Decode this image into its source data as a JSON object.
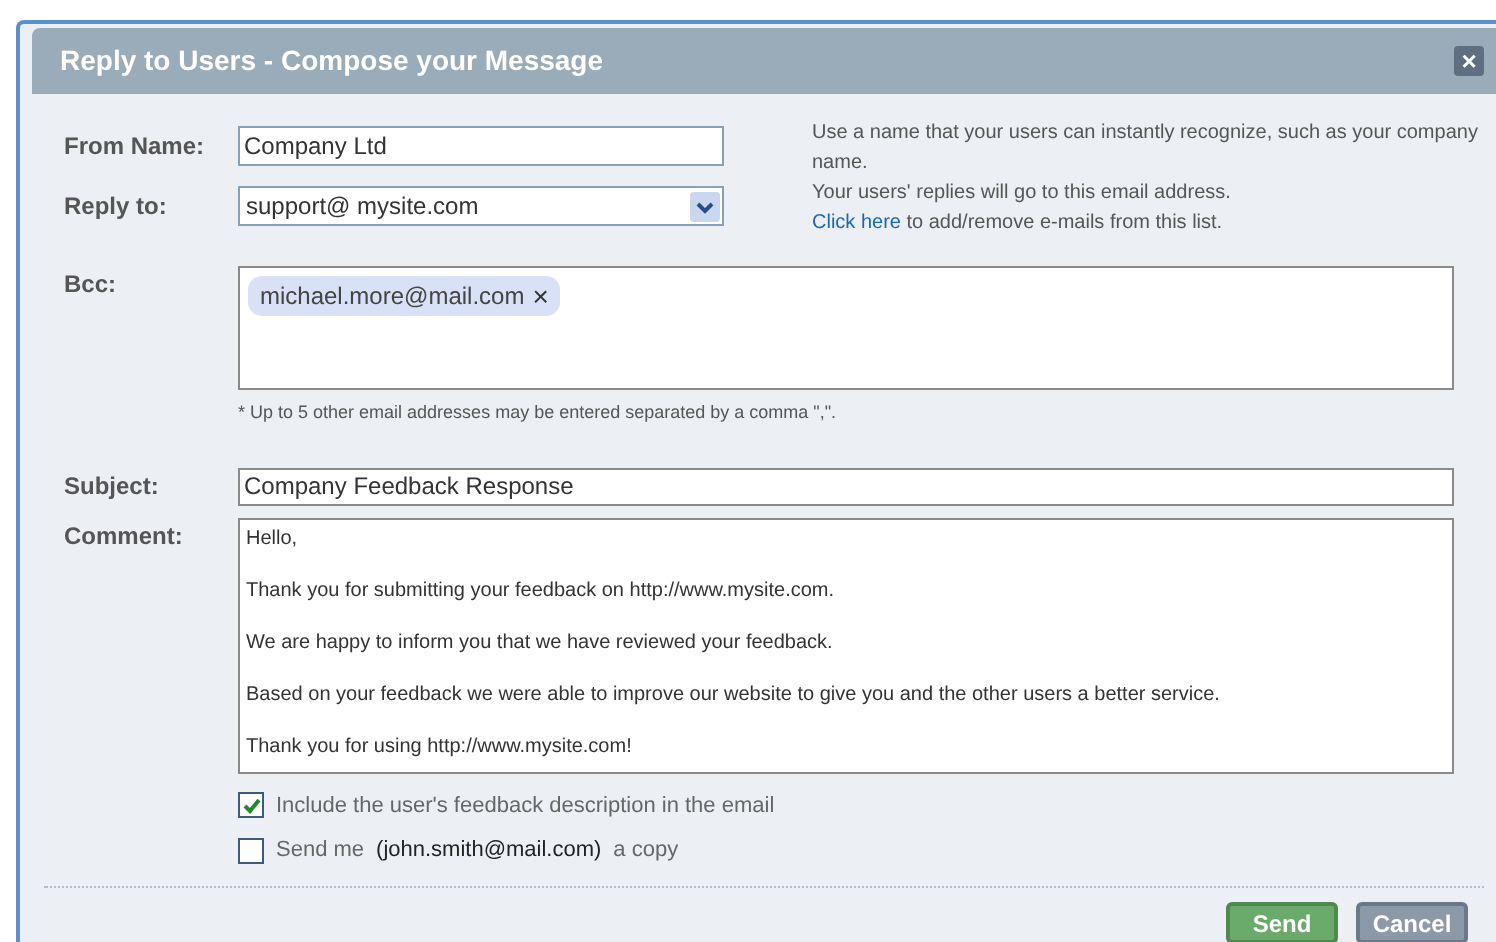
{
  "dialog": {
    "title": "Reply to Users - Compose your Message",
    "close": "×"
  },
  "from_name": {
    "label": "From Name:",
    "value": "Company Ltd"
  },
  "reply_to": {
    "label": "Reply to:",
    "value": "support@ mysite.com"
  },
  "help": {
    "line1": "Use a name that your users can instantly recognize, such as your company name.",
    "line2": "Your users' replies will go to this email address.",
    "link": "Click here",
    "line3": " to add/remove e-mails from this list."
  },
  "bcc": {
    "label": "Bcc:",
    "tokens": [
      {
        "text": "michael.more@mail.com",
        "remove": "×"
      }
    ],
    "note": "* Up to 5 other email addresses may be entered separated by a comma \",\"."
  },
  "subject": {
    "label": "Subject:",
    "value": "Company Feedback Response"
  },
  "comment": {
    "label": "Comment:",
    "lines": [
      "Hello,",
      "Thank you for submitting your feedback on http://www.mysite.com.",
      "We are happy to inform you that we have reviewed your feedback.",
      "Based on your feedback we were able to improve our website to give you and the other users a better service.",
      "Thank you for using http://www.mysite.com!"
    ]
  },
  "options": [
    {
      "parts": [
        "Include the user's feedback description in the email"
      ],
      "checked": true
    },
    {
      "parts": [
        "Send me",
        "(john.smith@mail.com)",
        "a copy"
      ],
      "checked": false
    }
  ],
  "buttons": [
    {
      "label": "Send",
      "kind": "primary"
    },
    {
      "label": "Cancel",
      "kind": "secondary"
    }
  ]
}
